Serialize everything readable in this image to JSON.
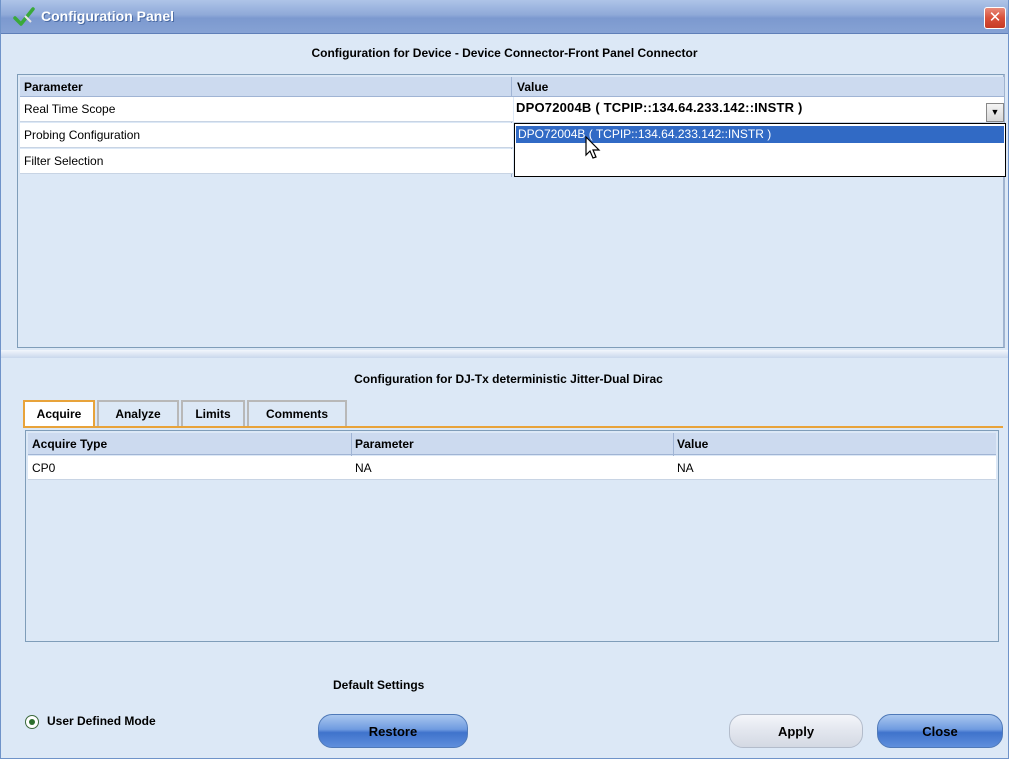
{
  "window": {
    "title": "Configuration Panel",
    "close_glyph": "✕"
  },
  "device": {
    "heading": "Configuration for Device - Device Connector-Front Panel Connector",
    "columns": [
      "Parameter",
      "Value"
    ],
    "rows": [
      {
        "parameter": "Real Time Scope"
      },
      {
        "parameter": "Probing Configuration"
      },
      {
        "parameter": "Filter Selection"
      }
    ],
    "scope_value": "DPO72004B ( TCPIP::134.64.233.142::INSTR )",
    "dropdown_options": [
      "DPO72004B ( TCPIP::134.64.233.142::INSTR )"
    ]
  },
  "test": {
    "heading": "Configuration for DJ-Tx deterministic Jitter-Dual Dirac",
    "tabs": [
      "Acquire",
      "Analyze",
      "Limits",
      "Comments"
    ],
    "active_tab": "Acquire",
    "columns": [
      "Acquire Type",
      "Parameter",
      "Value"
    ],
    "rows": [
      {
        "acquire_type": "CP0",
        "parameter": "NA",
        "value": "NA"
      }
    ]
  },
  "footer": {
    "default_settings_label": "Default Settings",
    "mode_label": "User Defined Mode",
    "restore_label": "Restore",
    "apply_label": "Apply",
    "close_label": "Close"
  },
  "icons": {
    "title": "checkmark-icon",
    "close": "close-icon",
    "dropdown": "chevron-down-icon",
    "cursor": "mouse-pointer-icon"
  },
  "colors": {
    "titlebar": "#8fa9d8",
    "panel_bg": "#dce8f6",
    "selection": "#316ac5",
    "active_tab_accent": "#e8a33a",
    "button_blue": "#3f73cc"
  }
}
